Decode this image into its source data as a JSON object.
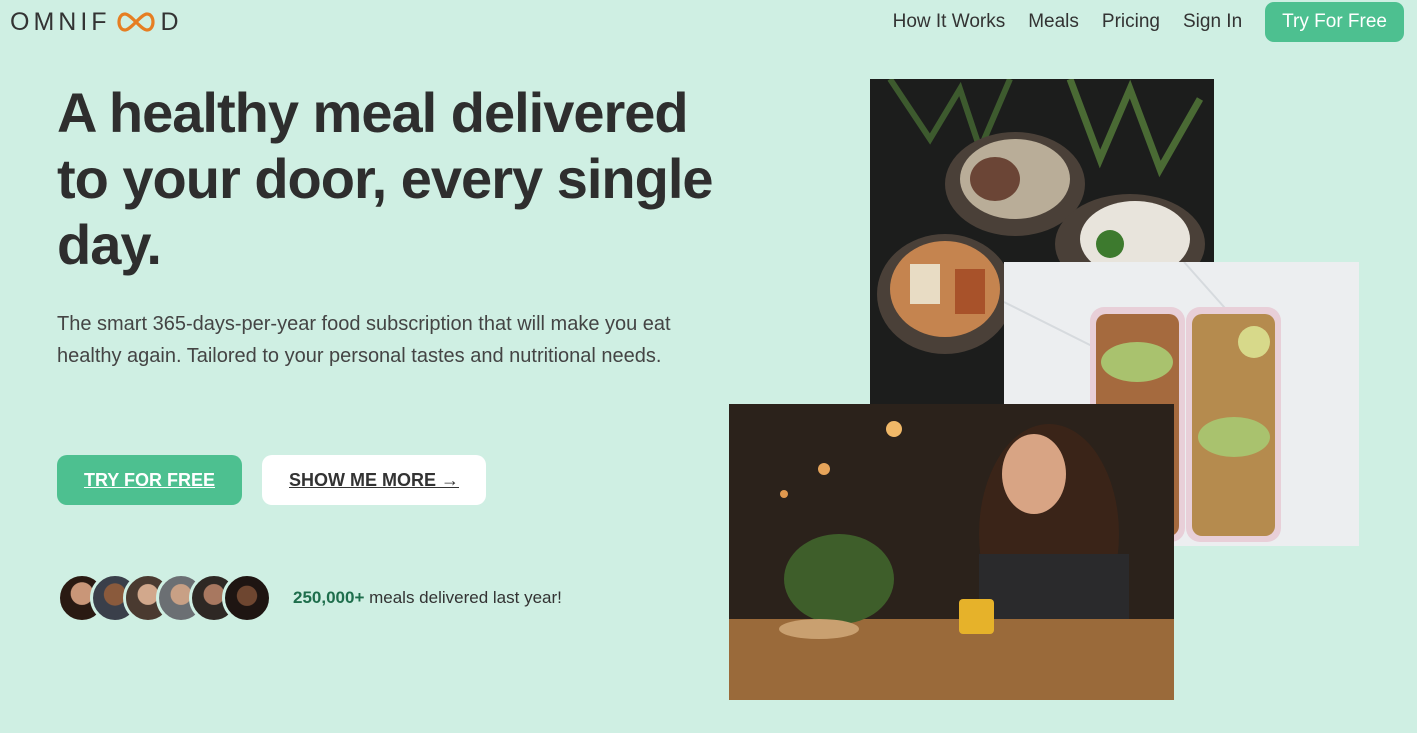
{
  "header": {
    "logo_left": "OMNIF",
    "logo_right": "D",
    "nav": [
      "How It Works",
      "Meals",
      "Pricing",
      "Sign In"
    ],
    "cta": "Try For Free"
  },
  "hero": {
    "headline": "A healthy meal delivered to your door, every single day.",
    "description": "The smart 365-days-per-year food subscription that will make you eat healthy again. Tailored to your personal tastes and nutritional needs.",
    "primary_button": "TRY FOR FREE",
    "secondary_button": "SHOW ME MORE →",
    "proof_count": "250,000+",
    "proof_text": " meals delivered last year!"
  },
  "colors": {
    "brand": "#4dc090",
    "background": "#cfefe3",
    "brand_orange": "#e67e22"
  }
}
